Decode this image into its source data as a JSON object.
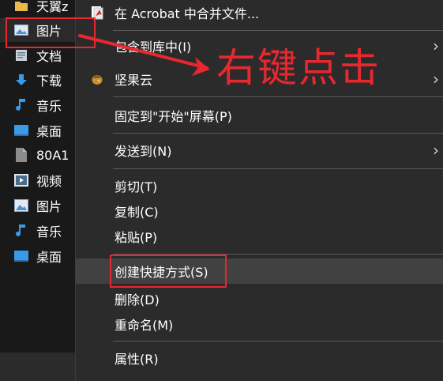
{
  "nav": {
    "items": [
      {
        "label": "天翼z",
        "icon": "folder-icon"
      },
      {
        "label": "图片",
        "icon": "pictures-icon"
      },
      {
        "label": "文档",
        "icon": "documents-icon"
      },
      {
        "label": "下载",
        "icon": "download-icon"
      },
      {
        "label": "音乐",
        "icon": "music-icon"
      },
      {
        "label": "桌面",
        "icon": "desktop-icon"
      },
      {
        "label": "80A1",
        "icon": "file-icon"
      },
      {
        "label": "视频",
        "icon": "video-icon"
      },
      {
        "label": "图片",
        "icon": "pictures-icon"
      },
      {
        "label": "音乐",
        "icon": "music-icon"
      },
      {
        "label": "桌面",
        "icon": "desktop-icon"
      }
    ]
  },
  "menu": {
    "items": [
      {
        "label": "在 Acrobat 中合并文件...",
        "icon": "acrobat-icon"
      },
      {
        "label": "包含到库中(I)"
      },
      {
        "label": "坚果云",
        "icon": "jianguoyun-icon"
      },
      {
        "label": "固定到\"开始\"屏幕(P)"
      },
      {
        "label": "发送到(N)"
      },
      {
        "label": "剪切(T)"
      },
      {
        "label": "复制(C)"
      },
      {
        "label": "粘贴(P)"
      },
      {
        "label": "创建快捷方式(S)"
      },
      {
        "label": "删除(D)"
      },
      {
        "label": "重命名(M)"
      },
      {
        "label": "属性(R)"
      }
    ],
    "submenu_arrow": "›"
  },
  "annotation": {
    "text": "右键点击",
    "color": "#e8282f"
  },
  "colors": {
    "background": "#191919",
    "menu_bg": "#2b2b2b",
    "hover_bg": "#414141",
    "highlight": "#e8282f"
  }
}
